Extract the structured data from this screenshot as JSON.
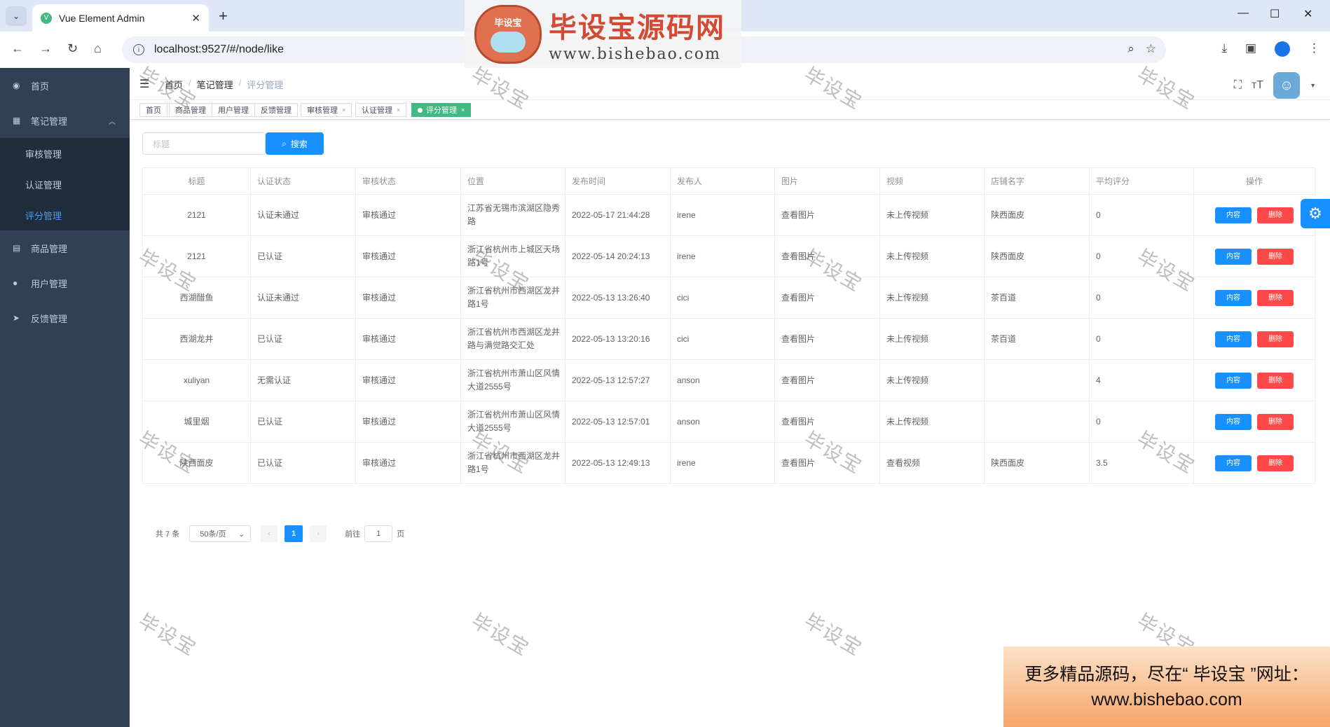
{
  "browser": {
    "tab_title": "Vue Element Admin",
    "url": "localhost:9527/#/node/like"
  },
  "watermark": {
    "brand": "毕设宝源码网",
    "domain": "www.bishebao.com",
    "logo_text": "毕设宝",
    "repeat_text": "毕设宝"
  },
  "sidebar": {
    "items": [
      {
        "label": "首页",
        "icon": "dashboard-icon"
      },
      {
        "label": "笔记管理",
        "icon": "table-icon"
      },
      {
        "label": "商品管理",
        "icon": "document-icon"
      },
      {
        "label": "用户管理",
        "icon": "user-icon"
      },
      {
        "label": "反馈管理",
        "icon": "send-icon"
      }
    ],
    "subitems": [
      {
        "label": "审核管理"
      },
      {
        "label": "认证管理"
      },
      {
        "label": "评分管理"
      }
    ]
  },
  "breadcrumb": [
    "首页",
    "笔记管理",
    "评分管理"
  ],
  "tags": [
    "首页",
    "商品管理",
    "用户管理",
    "反馈管理",
    "审核管理",
    "认证管理",
    "评分管理"
  ],
  "search": {
    "placeholder": "标题",
    "button": "搜索"
  },
  "table": {
    "headers": [
      "标题",
      "认证状态",
      "审核状态",
      "位置",
      "发布时间",
      "发布人",
      "图片",
      "视频",
      "店铺名字",
      "平均评分",
      "操作"
    ],
    "rows": [
      [
        "2121",
        "认证未通过",
        "审核通过",
        "江苏省无锡市滨湖区隐秀路",
        "2022-05-17 21:44:28",
        "irene",
        "查看图片",
        "未上传视频",
        "陕西面皮",
        "0"
      ],
      [
        "2121",
        "已认证",
        "审核通过",
        "浙江省杭州市上城区天场路1号",
        "2022-05-14 20:24:13",
        "irene",
        "查看图片",
        "未上传视频",
        "陕西面皮",
        "0"
      ],
      [
        "西湖醋鱼",
        "认证未通过",
        "审核通过",
        "浙江省杭州市西湖区龙井路1号",
        "2022-05-13 13:26:40",
        "cici",
        "查看图片",
        "未上传视频",
        "茶百道",
        "0"
      ],
      [
        "西湖龙井",
        "已认证",
        "审核通过",
        "浙江省杭州市西湖区龙井路与满觉路交汇处",
        "2022-05-13 13:20:16",
        "cici",
        "查看图片",
        "未上传视频",
        "茶百道",
        "0"
      ],
      [
        "xuliyan",
        "无需认证",
        "审核通过",
        "浙江省杭州市萧山区风情大道2555号",
        "2022-05-13 12:57:27",
        "anson",
        "查看图片",
        "未上传视频",
        "",
        "4"
      ],
      [
        "城里烟",
        "已认证",
        "审核通过",
        "浙江省杭州市萧山区风情大道2555号",
        "2022-05-13 12:57:01",
        "anson",
        "查看图片",
        "未上传视频",
        "",
        "0"
      ],
      [
        "陕西面皮",
        "已认证",
        "审核通过",
        "浙江省杭州市西湖区龙井路1号",
        "2022-05-13 12:49:13",
        "irene",
        "查看图片",
        "查看视频",
        "陕西面皮",
        "3.5"
      ]
    ],
    "btn_content": "内容",
    "btn_delete": "删除"
  },
  "pager": {
    "total": "共 7 条",
    "size": "50条/页",
    "current": "1",
    "goto_label": "前往",
    "goto_value": "1",
    "page_unit": "页"
  },
  "promo": {
    "line1": "更多精品源码，尽在“ 毕设宝 ”网址：",
    "line2": "www.bishebao.com"
  }
}
